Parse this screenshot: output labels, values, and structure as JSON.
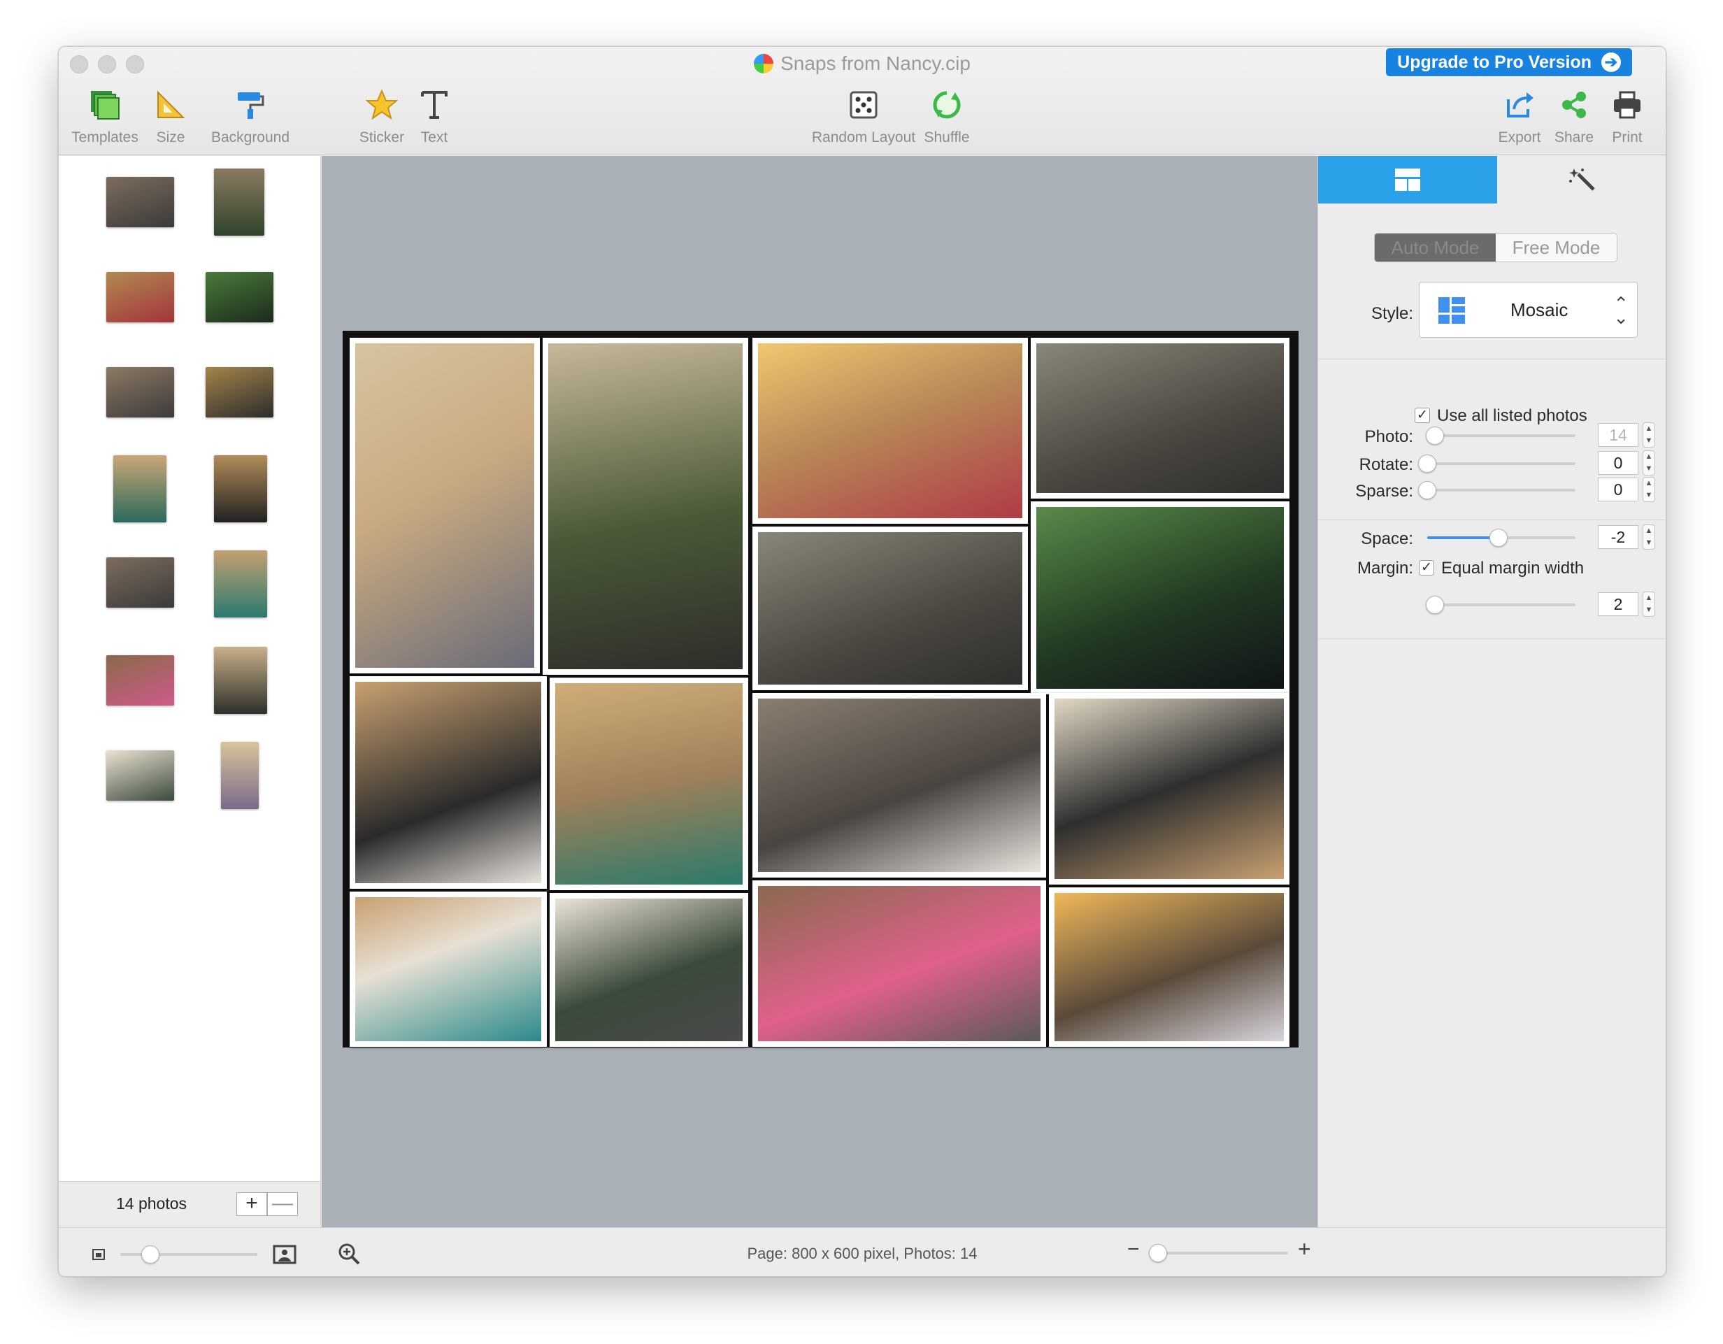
{
  "window": {
    "title": "Snaps from Nancy.cip",
    "upgrade_label": "Upgrade to Pro Version"
  },
  "toolbar": {
    "templates": "Templates",
    "size": "Size",
    "background": "Background",
    "sticker": "Sticker",
    "text": "Text",
    "random_layout": "Random Layout",
    "shuffle": "Shuffle",
    "export": "Export",
    "share": "Share",
    "print": "Print"
  },
  "photo_list": {
    "count_label": "14 photos",
    "add": "+",
    "remove": "—"
  },
  "panel": {
    "auto_mode": "Auto Mode",
    "free_mode": "Free Mode",
    "style_label": "Style:",
    "style_value": "Mosaic",
    "use_all_label": "Use all listed photos",
    "photo_label": "Photo:",
    "photo_value": "14",
    "photo_slider": 0.05,
    "rotate_label": "Rotate:",
    "rotate_value": "0",
    "rotate_slider": 0,
    "sparse_label": "Sparse:",
    "sparse_value": "0",
    "sparse_slider": 0,
    "space_label": "Space:",
    "space_value": "-2",
    "space_slider": 0.48,
    "margin_label": "Margin:",
    "equal_margin_label": "Equal margin width",
    "margin_value": "2",
    "margin_slider": 0.05
  },
  "status": {
    "text": "Page: 800 x 600 pixel, Photos: 14",
    "thumb_size_slider": 0.22,
    "zoom_slider": 0.05,
    "zoom_minus": "−",
    "zoom_plus": "+"
  },
  "colors": {
    "accent": "#2aa1e8",
    "upgrade": "#1782e0",
    "canvas_bg": "#a9b0b6"
  }
}
